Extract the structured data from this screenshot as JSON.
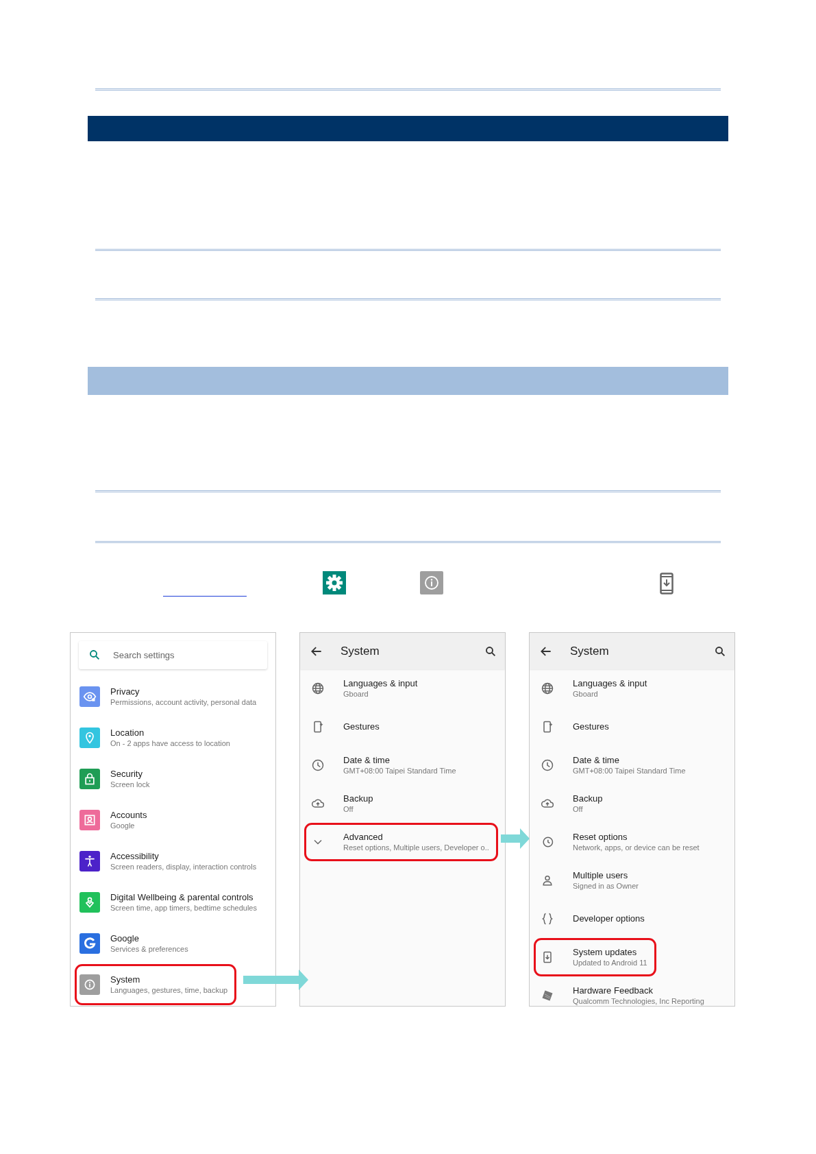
{
  "screens": [
    {
      "kind": "home",
      "search": {
        "placeholder": "Search settings"
      },
      "items": [
        {
          "title": "Privacy",
          "subtitle": "Permissions, account activity, personal data",
          "color": "#6a93f0",
          "highlighted": false
        },
        {
          "title": "Location",
          "subtitle": "On - 2 apps have access to location",
          "color": "#33c5e0",
          "highlighted": false
        },
        {
          "title": "Security",
          "subtitle": "Screen lock",
          "color": "#1f9d55",
          "highlighted": false
        },
        {
          "title": "Accounts",
          "subtitle": "Google",
          "color": "#ee6b9a",
          "highlighted": false
        },
        {
          "title": "Accessibility",
          "subtitle": "Screen readers, display, interaction controls",
          "color": "#4c22c9",
          "highlighted": false
        },
        {
          "title": "Digital Wellbeing & parental controls",
          "subtitle": "Screen time, app timers, bedtime schedules",
          "color": "#21c15b",
          "highlighted": false
        },
        {
          "title": "Google",
          "subtitle": "Services & preferences",
          "color": "#2a6fe0",
          "highlighted": false
        },
        {
          "title": "System",
          "subtitle": "Languages, gestures, time, backup",
          "color": "#9e9e9e",
          "highlighted": true
        }
      ]
    },
    {
      "kind": "list",
      "title": "System",
      "items": [
        {
          "title": "Languages & input",
          "subtitle": "Gboard",
          "highlighted": false
        },
        {
          "title": "Gestures",
          "highlighted": false
        },
        {
          "title": "Date & time",
          "subtitle": "GMT+08:00 Taipei Standard Time",
          "highlighted": false
        },
        {
          "title": "Backup",
          "subtitle": "Off",
          "highlighted": false
        },
        {
          "title": "Advanced",
          "subtitle": "Reset options, Multiple users, Developer o..",
          "highlighted": true
        }
      ]
    },
    {
      "kind": "list",
      "title": "System",
      "items": [
        {
          "title": "Languages & input",
          "subtitle": "Gboard",
          "highlighted": false
        },
        {
          "title": "Gestures",
          "highlighted": false
        },
        {
          "title": "Date & time",
          "subtitle": "GMT+08:00 Taipei Standard Time",
          "highlighted": false
        },
        {
          "title": "Backup",
          "subtitle": "Off",
          "highlighted": false
        },
        {
          "title": "Reset options",
          "subtitle": "Network, apps, or device can be reset",
          "highlighted": false
        },
        {
          "title": "Multiple users",
          "subtitle": "Signed in as Owner",
          "highlighted": false
        },
        {
          "title": "Developer options",
          "highlighted": false
        },
        {
          "title": "System updates",
          "subtitle": "Updated to Android 11",
          "highlighted": true
        },
        {
          "title": "Hardware Feedback",
          "subtitle": "Qualcomm Technologies, Inc Reporting",
          "highlighted": false
        }
      ]
    }
  ]
}
